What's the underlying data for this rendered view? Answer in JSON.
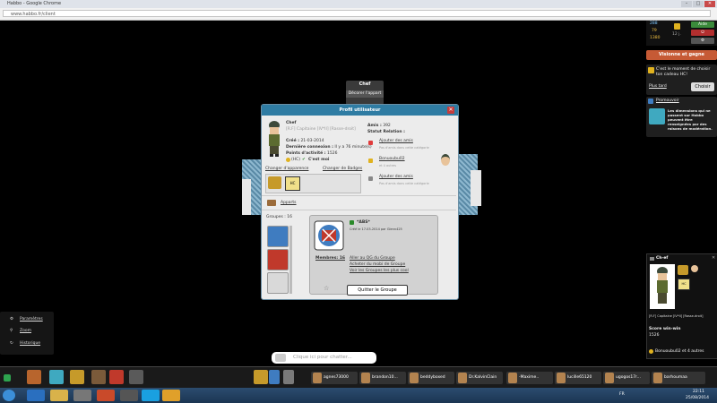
{
  "window": {
    "title": "Habbo - Google Chrome",
    "url": "www.habbo.fr/client"
  },
  "room": {
    "selected_user": "Chef",
    "context_action": "Décorer l'appart"
  },
  "profile": {
    "header": "Profil utilisateur",
    "name": "Chef",
    "motto": "[R.F] Capitaine [IV*II] [Rasse-droit]",
    "created_label": "Créé :",
    "created_value": "21-03-2014",
    "last_login_label": "Dernière connexion :",
    "last_login_value": "Il y a 76 minute(s)",
    "activity_label": "Points d'activité :",
    "activity_value": "1526",
    "hc_label": "(HC)",
    "me_label": "C'est moi",
    "change_look": "Changer d'apparence",
    "change_badges": "Changer de Badges",
    "friends_label": "Amis :",
    "friends_count": "392",
    "relation_status": "Statut Relation :",
    "relations": [
      {
        "action": "Ajouter des amis",
        "note": "Pas d'amis dans cette catégorie",
        "color": "#e03b3b"
      },
      {
        "action": "Bonuoubu02",
        "note": "et 4 autres",
        "color": "#e0b21f"
      },
      {
        "action": "Ajouter des amis",
        "note": "Pas d'amis dans cette catégorie",
        "color": "#888888"
      }
    ],
    "rooms_label": "Apparts",
    "groups_label": "Groupes :",
    "groups_count": "16",
    "group": {
      "name": "*ABS*",
      "created": "Créé le 17-03-2014 par Glenn425",
      "members": "Membres: 16",
      "links": [
        "Aller au QG du Groupe",
        "Acheter du mobi de Groupe",
        "Voir les Groupes les plus cool"
      ],
      "leave": "Quitter le Groupe"
    }
  },
  "currency": {
    "diamonds": "288",
    "duckets": "79",
    "credits": "1380",
    "hc_days": "12 j.",
    "help": "Aide"
  },
  "visionne": "Visionne et gagne",
  "hc_offer": {
    "text": "C'est le moment de choisir ton cadeau HC!",
    "later": "Plus tard",
    "choose": "Choisir"
  },
  "promo": {
    "title": "Promouvoir",
    "text": "Les dimensions qui ne passent sur Habbo peuvent être renseignées par des raisons de modération."
  },
  "userinfo": {
    "name": "Ch-ef",
    "motto": "[R.F] Capitaine [IV*II] [Rasse-droit]",
    "score": "Score win-win",
    "score_value": "1526",
    "relation": "Bonuoubu02 et 4 autres"
  },
  "left_panel": [
    "Paramètres",
    "Zoom",
    "Historique"
  ],
  "chat_placeholder": "Clique ici pour chatter...",
  "friends_bar": [
    "agnes73000",
    "brandon10...",
    "beddyboxed",
    "Dr.KalvinClain",
    "-Maxime..",
    "lucille65120",
    "ugogos17r...",
    "barhoumaa"
  ],
  "taskbar": {
    "lang": "FR",
    "time": "22:11",
    "date": "25/08/2014"
  },
  "colors": {
    "header": "#2f7ca3",
    "accent": "#c65a35",
    "close": "#c63c3c"
  }
}
